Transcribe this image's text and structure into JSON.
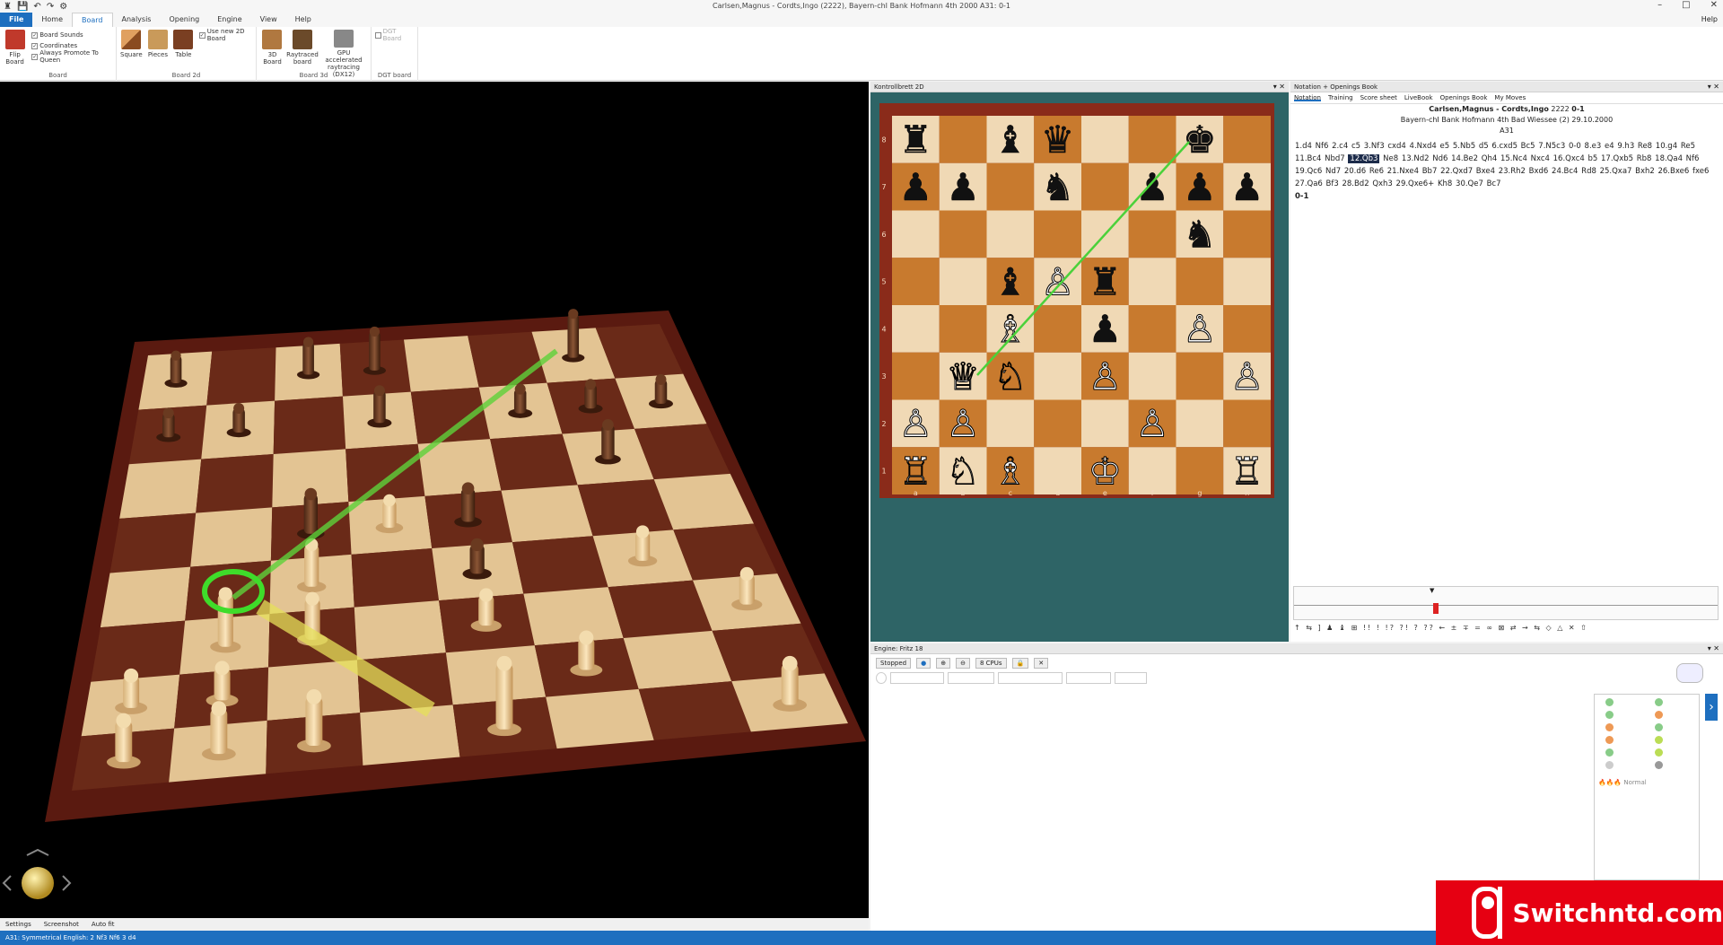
{
  "window": {
    "title": "Carlsen,Magnus - Cordts,Ingo (2222), Bayern-chI Bank Hofmann 4th 2000  A31: 0-1",
    "min": "–",
    "max": "□",
    "close": "✕"
  },
  "qat": [
    "♜",
    "💾",
    "↶",
    "↷",
    "⚙"
  ],
  "tabs": [
    "File",
    "Home",
    "Board",
    "Analysis",
    "Opening",
    "Engine",
    "View",
    "Help"
  ],
  "help": "Help",
  "ribbon": {
    "board": {
      "label": "Board",
      "flip": "Flip Board",
      "checks": [
        "Board Sounds",
        "Coordinates",
        "Always Promote To Queen"
      ]
    },
    "board2d": {
      "label": "Board 2d",
      "buttons": [
        "Square",
        "Pieces",
        "Table"
      ],
      "check": "Use new 2D Board"
    },
    "board3d": {
      "label": "Board 3d",
      "buttons": [
        "3D Board",
        "Raytraced board",
        "GPU accelerated raytracing (DX12)"
      ]
    },
    "dgt": {
      "label": "DGT board",
      "check": "DGT Board"
    }
  },
  "footer3d": [
    "Settings",
    "Screenshot",
    "Auto fit"
  ],
  "statusbar": "A31: Symmetrical English: 2 Nf3 Nf6 3 d4",
  "board2d": {
    "title": "Kontrollbrett 2D",
    "files": [
      "a",
      "b",
      "c",
      "d",
      "e",
      "f",
      "g",
      "h"
    ],
    "ranks": [
      "8",
      "7",
      "6",
      "5",
      "4",
      "3",
      "2",
      "1"
    ],
    "pieces": [
      [
        "♜",
        "",
        "♝",
        "♛",
        "",
        "",
        "♚",
        ""
      ],
      [
        "♟",
        "♟",
        "",
        "♞",
        "",
        "♟",
        "♟",
        "♟"
      ],
      [
        "",
        "",
        "",
        "",
        "",
        "",
        "♞",
        ""
      ],
      [
        "",
        "",
        "♝",
        "♙",
        "♜",
        "",
        "",
        ""
      ],
      [
        "",
        "",
        "♗",
        "",
        "♟",
        "",
        "♙",
        ""
      ],
      [
        "",
        "♕",
        "♘",
        "",
        "♙",
        "",
        "",
        "♙"
      ],
      [
        "♙",
        "♙",
        "",
        "",
        "",
        "♙",
        "",
        ""
      ],
      [
        "♖",
        "♘",
        "♗",
        "",
        "♔",
        "",
        "",
        "♖"
      ]
    ],
    "colors": {
      "light": "#f0d9b5",
      "dark": "#c87a2e",
      "frame": "#8a2b1a"
    }
  },
  "notation": {
    "title": "Notation + Openings Book",
    "tabs": [
      "Notation",
      "Training",
      "Score sheet",
      "LiveBook",
      "Openings Book",
      "My Moves"
    ],
    "white": "Carlsen,Magnus - Cordts,Ingo",
    "rating": "2222",
    "result": "0-1",
    "event": "Bayern-chI Bank Hofmann 4th Bad Wiessee (2)  29.10.2000",
    "eco": "A31",
    "moves_before": "1.d4  Nf6  2.c4  c5  3.Nf3  cxd4  4.Nxd4  e5  5.Nb5  d5  6.cxd5  Bc5  7.N5c3  0-0  8.e3  e4  9.h3  Re8  10.g4  Re5  11.Bc4  Nbd7",
    "current": "12.Qb3",
    "moves_after": "Ne8  13.Nd2  Nd6  14.Be2  Qh4  15.Nc4  Nxc4  16.Qxc4  b5  17.Qxb5  Rb8  18.Qa4  Nf6  19.Qc6  Nd7  20.d6  Re6  21.Nxe4  Bb7  22.Qxd7  Bxe4  23.Rh2  Bxd6  24.Bc4  Rd8  25.Qxa7  Bxh2  26.Bxe6  fxe6  27.Qa6  Bf3  28.Bd2  Qxh3  29.Qxe6+  Kh8  30.Qe7  Bc7",
    "final": "0-1",
    "symbols": "↑ ⇆ ] ♟ ♝ ⊞ !! ! !? ?! ? ?? ← ± ∓ = ∞ ⊠ ⇄ → ⇆ ◇ △ ✕ ⇧"
  },
  "engine": {
    "title": "Engine: Fritz 18",
    "status": "Stopped",
    "cpus": "8 CPUs",
    "eval_label": "Normal"
  },
  "badge": {
    "text": "Switchntd.com"
  }
}
